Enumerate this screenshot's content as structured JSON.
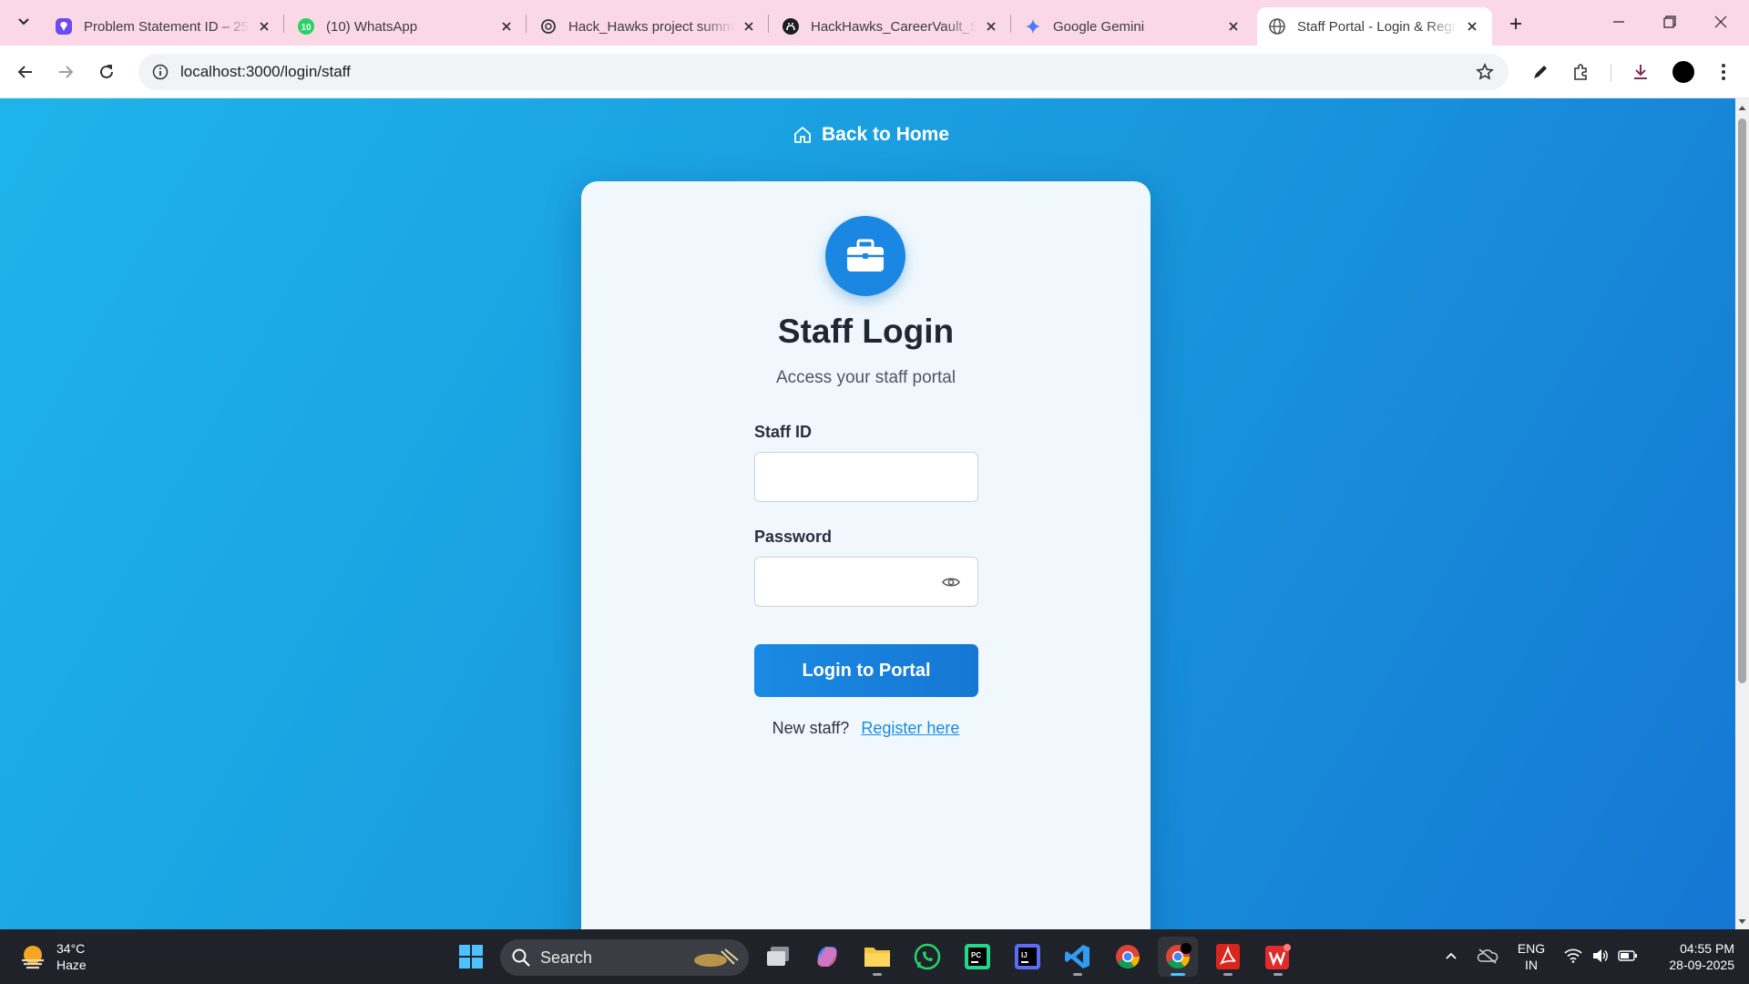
{
  "browser": {
    "tabs": [
      {
        "title": "Problem Statement ID – 25",
        "icon": "app-icon"
      },
      {
        "title": "(10) WhatsApp",
        "icon": "whatsapp-icon",
        "badge": "10"
      },
      {
        "title": "Hack_Hawks project summ",
        "icon": "openai-icon"
      },
      {
        "title": "HackHawks_CareerVault_SI",
        "icon": "github-icon"
      },
      {
        "title": "Google Gemini",
        "icon": "gemini-icon"
      },
      {
        "title": "Staff Portal - Login & Regi",
        "icon": "globe-icon",
        "active": true
      }
    ],
    "url": "localhost:3000/login/staff"
  },
  "page": {
    "back_home": "Back to Home",
    "title": "Staff Login",
    "subtitle": "Access your staff portal",
    "staff_id_label": "Staff ID",
    "staff_id_value": "",
    "password_label": "Password",
    "password_value": "",
    "login_button": "Login to Portal",
    "register_prompt": "New staff?",
    "register_link": "Register here",
    "accent_color": "#1a87e2"
  },
  "taskbar": {
    "weather_temp": "34°C",
    "weather_desc": "Haze",
    "search_label": "Search",
    "lang_primary": "ENG",
    "lang_secondary": "IN",
    "time": "04:55 PM",
    "date": "28-09-2025",
    "apps": [
      "windows-start",
      "task-view",
      "copilot",
      "file-explorer",
      "whatsapp",
      "pycharm",
      "intellij",
      "vscode",
      "chrome",
      "chrome-active",
      "acrobat",
      "wps-office"
    ]
  }
}
